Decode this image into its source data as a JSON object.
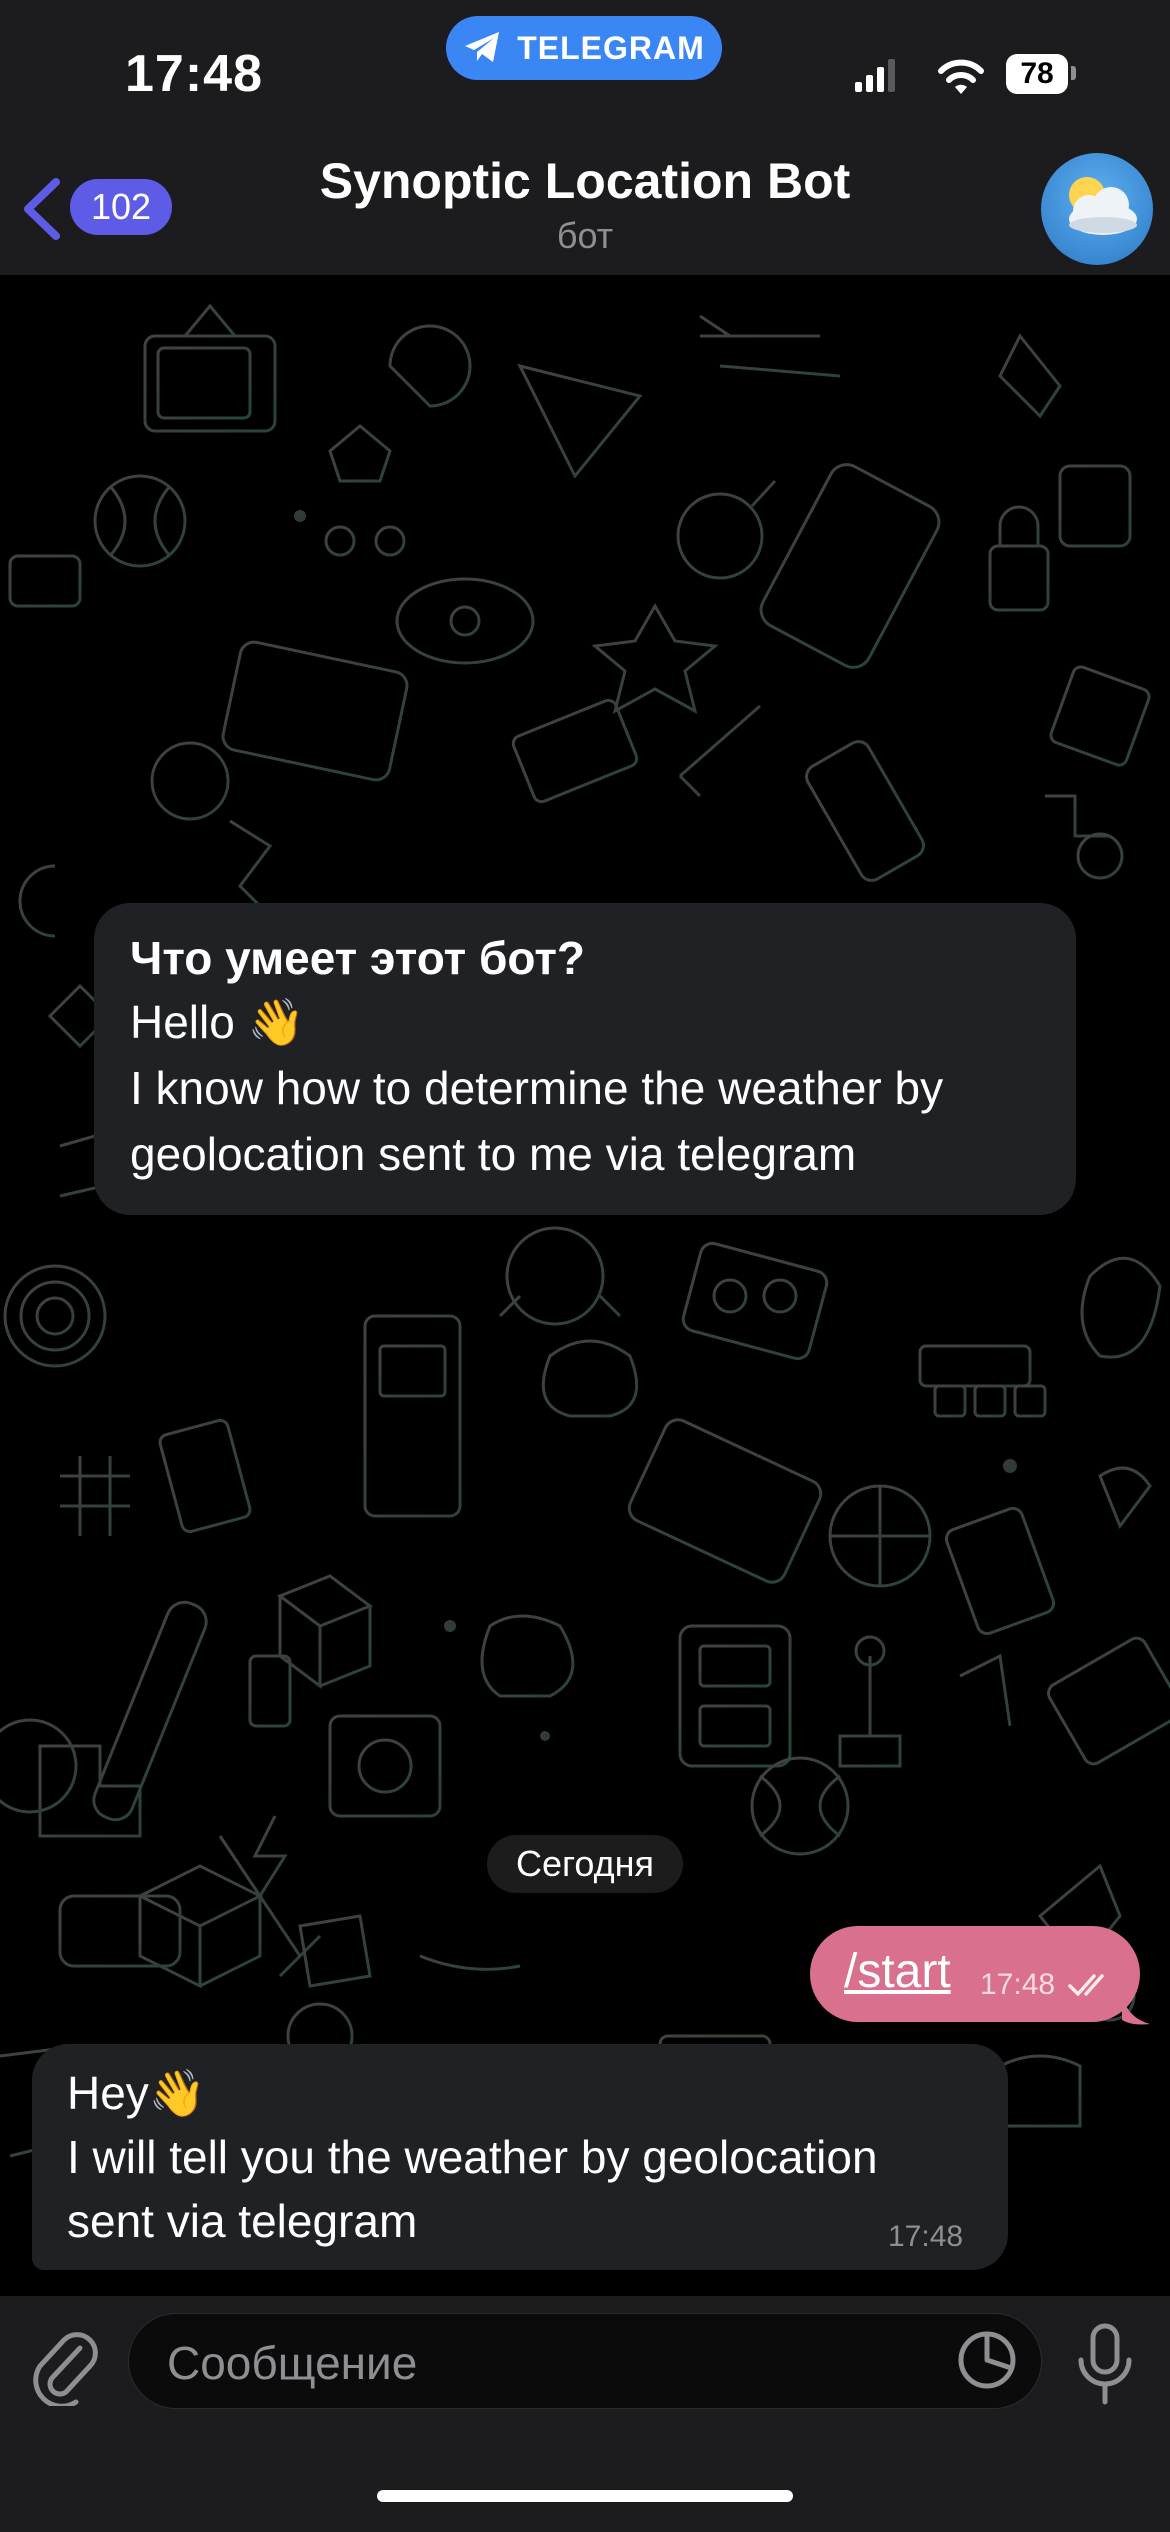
{
  "status_bar": {
    "time": "17:48",
    "app_pill": "TELEGRAM",
    "battery": "78"
  },
  "header": {
    "back_count": "102",
    "title": "Synoptic Location Bot",
    "subtitle": "бот"
  },
  "bot_info": {
    "title": "Что умеет этот бот?",
    "lines": [
      "Hello 👋",
      "I know how to determine the weather by",
      "geolocation sent to me via telegram"
    ]
  },
  "date_separator": "Сегодня",
  "messages": [
    {
      "direction": "out",
      "text": "/start",
      "time": "17:48",
      "status": "read"
    },
    {
      "direction": "in",
      "lines": [
        "Hey👋",
        "I will tell you the weather by geolocation",
        "sent via telegram"
      ],
      "time": "17:48"
    }
  ],
  "composer": {
    "placeholder": "Сообщение"
  },
  "colors": {
    "accent": "#5e5ce6",
    "outgoing_bubble": "#d9708d",
    "incoming_bubble": "#1f2125",
    "telegram_pill": "#3a86f5",
    "bar_background": "#1c1c1e"
  },
  "icons": [
    "back-chevron-icon",
    "telegram-plane-icon",
    "signal-icon",
    "wifi-icon",
    "battery-icon",
    "weather-cloud-sun-icon",
    "double-check-icon",
    "paperclip-icon",
    "sticker-icon",
    "microphone-icon"
  ]
}
